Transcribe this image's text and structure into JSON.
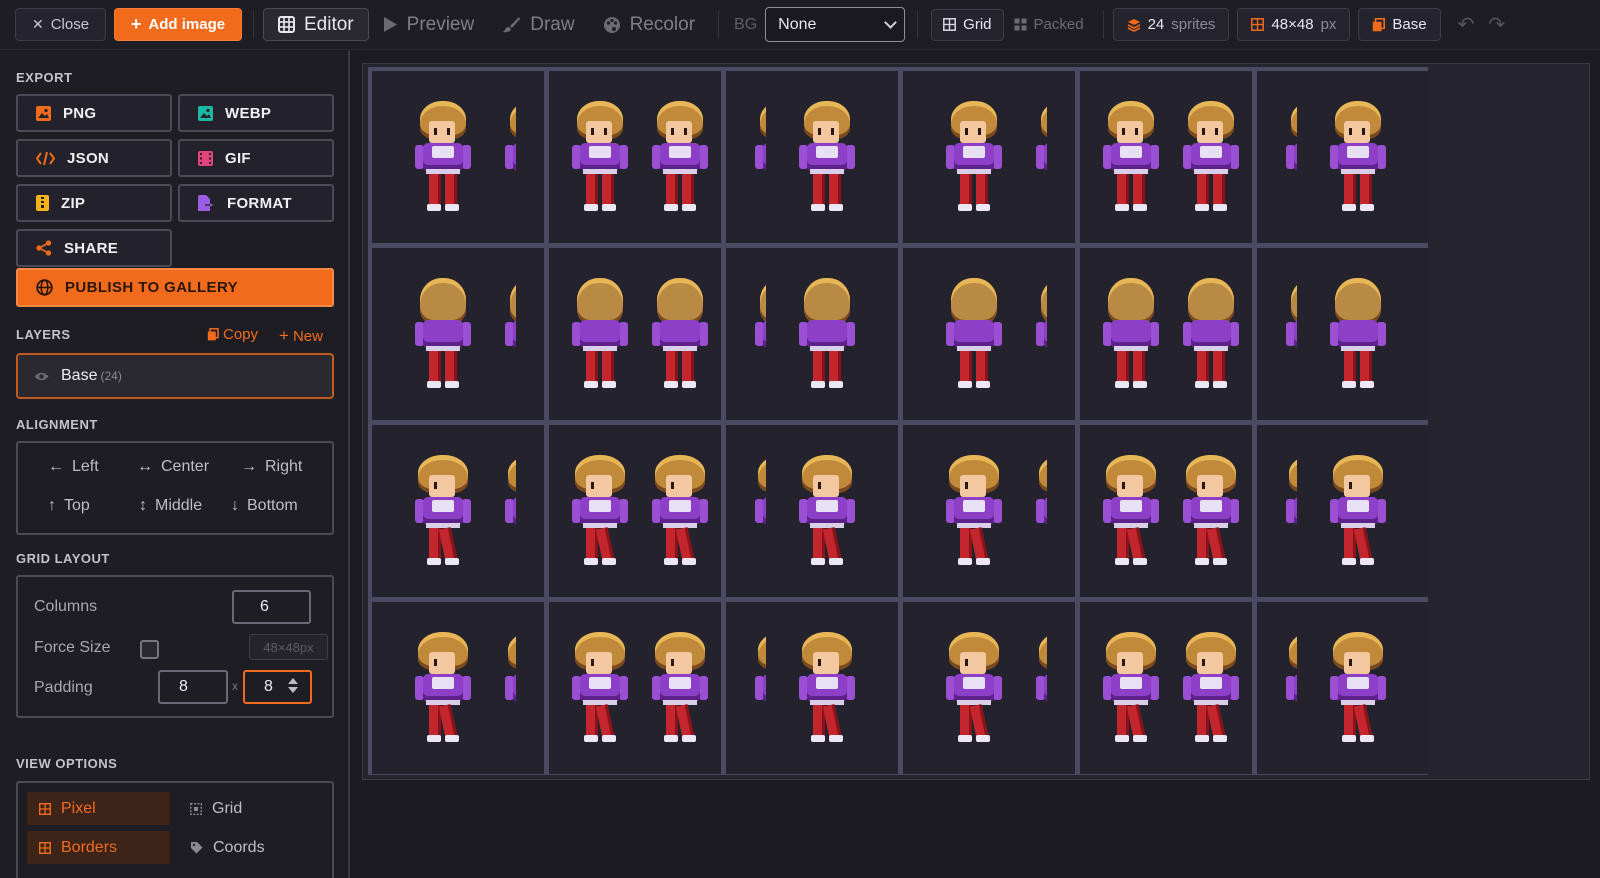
{
  "toolbar": {
    "close_label": "Close",
    "add_image_label": "Add image",
    "tabs": [
      {
        "label": "Editor",
        "icon": "grid-icon",
        "active": true
      },
      {
        "label": "Preview",
        "icon": "play-icon",
        "active": false
      },
      {
        "label": "Draw",
        "icon": "brush-icon",
        "active": false
      },
      {
        "label": "Recolor",
        "icon": "palette-icon",
        "active": false
      }
    ],
    "bg_label": "BG",
    "bg_select_value": "None",
    "mode_grid_label": "Grid",
    "mode_packed_label": "Packed",
    "sprite_count": "24",
    "sprite_count_unit": "sprites",
    "sprite_size": "48×48",
    "sprite_size_unit": "px",
    "layer_label": "Base"
  },
  "sidebar": {
    "export": {
      "title": "EXPORT",
      "buttons": [
        {
          "label": "PNG",
          "icon": "image-icon",
          "color": "#f26b1d"
        },
        {
          "label": "WEBP",
          "icon": "image-icon",
          "color": "#1bb8a4"
        },
        {
          "label": "JSON",
          "icon": "code-icon",
          "color": "#f26b1d"
        },
        {
          "label": "GIF",
          "icon": "film-icon",
          "color": "#e0467c"
        },
        {
          "label": "ZIP",
          "icon": "zip-file-icon",
          "color": "#f2b21d"
        },
        {
          "label": "FORMAT",
          "icon": "file-export-icon",
          "color": "#9b5de5"
        },
        {
          "label": "SHARE",
          "icon": "share-icon",
          "color": "#f26b1d"
        }
      ],
      "publish_label": "PUBLISH TO GALLERY"
    },
    "layers": {
      "title": "LAYERS",
      "copy_label": "Copy",
      "new_label": "New",
      "items": [
        {
          "name": "Base",
          "count": "(24)"
        }
      ]
    },
    "alignment": {
      "title": "ALIGNMENT",
      "items": [
        {
          "label": "Left",
          "icon": "←"
        },
        {
          "label": "Center",
          "icon": "↔"
        },
        {
          "label": "Right",
          "icon": "→"
        },
        {
          "label": "Top",
          "icon": "↑"
        },
        {
          "label": "Middle",
          "icon": "↕"
        },
        {
          "label": "Bottom",
          "icon": "↓"
        }
      ]
    },
    "grid_layout": {
      "title": "GRID LAYOUT",
      "columns_label": "Columns",
      "columns_value": "6",
      "force_size_label": "Force Size",
      "force_size_checked": false,
      "force_size_placeholder": "48×48px",
      "padding_label": "Padding",
      "padding_x": "8",
      "padding_sep": "x",
      "padding_y": "8"
    },
    "view_options": {
      "title": "VIEW OPTIONS",
      "items": [
        {
          "label": "Pixel",
          "on": true
        },
        {
          "label": "Grid",
          "on": false
        },
        {
          "label": "Borders",
          "on": true
        },
        {
          "label": "Coords",
          "on": false
        }
      ]
    }
  },
  "canvas": {
    "columns": 6,
    "rows": 4,
    "accent": "#4b4a63",
    "sprite_rows": [
      "front",
      "back",
      "side",
      "side"
    ]
  }
}
